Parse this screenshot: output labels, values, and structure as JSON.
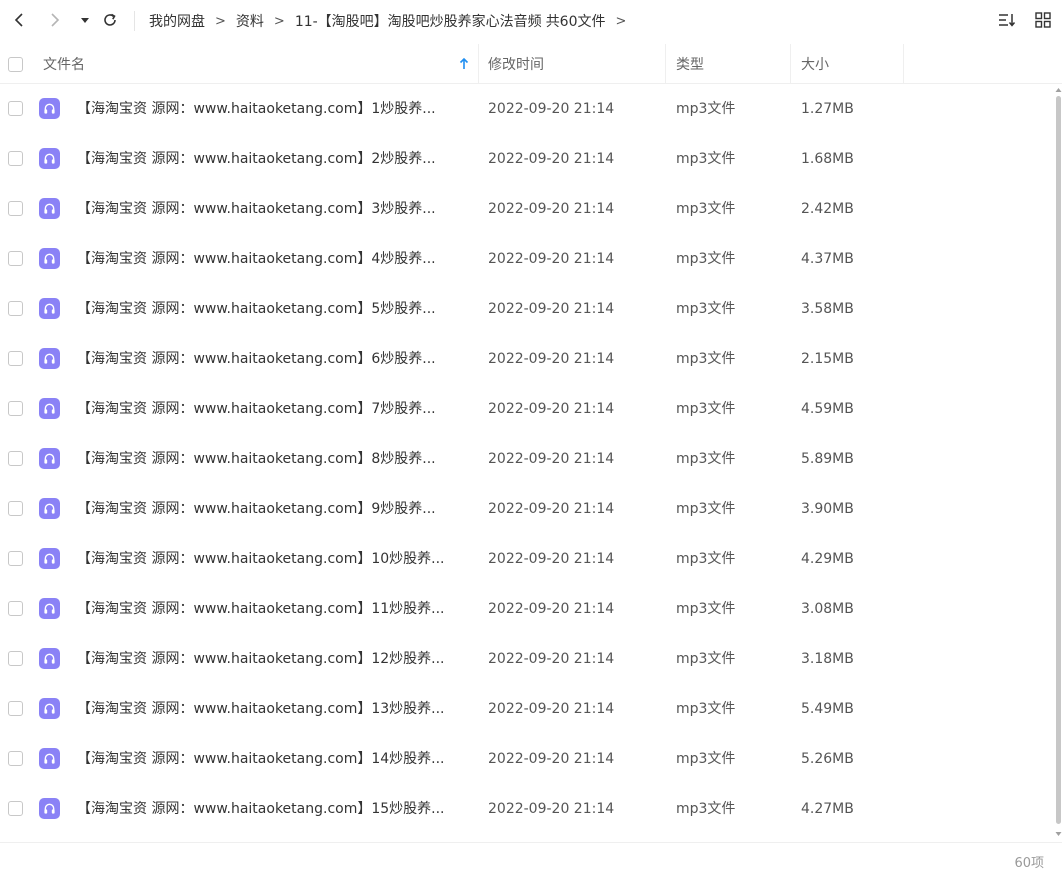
{
  "toolbar": {
    "breadcrumbs": [
      {
        "label": "我的网盘"
      },
      {
        "label": "资料"
      },
      {
        "label": "11-【淘股吧】淘股吧炒股养家心法音频"
      }
    ],
    "folder_count": "共60文件",
    "separator": ">"
  },
  "columns": {
    "name": "文件名",
    "modified": "修改时间",
    "type": "类型",
    "size": "大小"
  },
  "files": [
    {
      "name": "【海淘宝资 源网：www.haitaoketang.com】1炒股养...",
      "modified": "2022-09-20 21:14",
      "type": "mp3文件",
      "size": "1.27MB"
    },
    {
      "name": "【海淘宝资 源网：www.haitaoketang.com】2炒股养...",
      "modified": "2022-09-20 21:14",
      "type": "mp3文件",
      "size": "1.68MB"
    },
    {
      "name": "【海淘宝资 源网：www.haitaoketang.com】3炒股养...",
      "modified": "2022-09-20 21:14",
      "type": "mp3文件",
      "size": "2.42MB"
    },
    {
      "name": "【海淘宝资 源网：www.haitaoketang.com】4炒股养...",
      "modified": "2022-09-20 21:14",
      "type": "mp3文件",
      "size": "4.37MB"
    },
    {
      "name": "【海淘宝资 源网：www.haitaoketang.com】5炒股养...",
      "modified": "2022-09-20 21:14",
      "type": "mp3文件",
      "size": "3.58MB"
    },
    {
      "name": "【海淘宝资 源网：www.haitaoketang.com】6炒股养...",
      "modified": "2022-09-20 21:14",
      "type": "mp3文件",
      "size": "2.15MB"
    },
    {
      "name": "【海淘宝资 源网：www.haitaoketang.com】7炒股养...",
      "modified": "2022-09-20 21:14",
      "type": "mp3文件",
      "size": "4.59MB"
    },
    {
      "name": "【海淘宝资 源网：www.haitaoketang.com】8炒股养...",
      "modified": "2022-09-20 21:14",
      "type": "mp3文件",
      "size": "5.89MB"
    },
    {
      "name": "【海淘宝资 源网：www.haitaoketang.com】9炒股养...",
      "modified": "2022-09-20 21:14",
      "type": "mp3文件",
      "size": "3.90MB"
    },
    {
      "name": "【海淘宝资 源网：www.haitaoketang.com】10炒股养...",
      "modified": "2022-09-20 21:14",
      "type": "mp3文件",
      "size": "4.29MB"
    },
    {
      "name": "【海淘宝资 源网：www.haitaoketang.com】11炒股养...",
      "modified": "2022-09-20 21:14",
      "type": "mp3文件",
      "size": "3.08MB"
    },
    {
      "name": "【海淘宝资 源网：www.haitaoketang.com】12炒股养...",
      "modified": "2022-09-20 21:14",
      "type": "mp3文件",
      "size": "3.18MB"
    },
    {
      "name": "【海淘宝资 源网：www.haitaoketang.com】13炒股养...",
      "modified": "2022-09-20 21:14",
      "type": "mp3文件",
      "size": "5.49MB"
    },
    {
      "name": "【海淘宝资 源网：www.haitaoketang.com】14炒股养...",
      "modified": "2022-09-20 21:14",
      "type": "mp3文件",
      "size": "5.26MB"
    },
    {
      "name": "【海淘宝资 源网：www.haitaoketang.com】15炒股养...",
      "modified": "2022-09-20 21:14",
      "type": "mp3文件",
      "size": "4.27MB"
    }
  ],
  "footer": {
    "count": "60项"
  },
  "colors": {
    "file_icon": "#8a82f6",
    "sort_arrow": "#1f8ef1"
  }
}
